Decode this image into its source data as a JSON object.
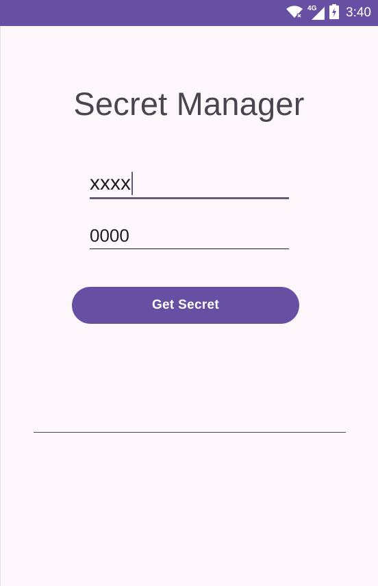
{
  "status_bar": {
    "network_label": "4G",
    "time": "3:40",
    "icons": [
      "wifi-icon",
      "cell-signal-icon",
      "battery-charging-icon"
    ]
  },
  "app": {
    "title": "Secret Manager"
  },
  "form": {
    "field1_value": "xxxx",
    "field2_value": "0000",
    "button_label": "Get Secret"
  },
  "colors": {
    "accent": "#6750a4",
    "background": "#fdf7fc",
    "text": "#1c1b1f",
    "title_text": "#49454f"
  }
}
